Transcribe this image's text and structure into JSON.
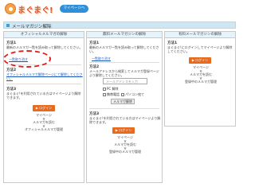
{
  "header": {
    "logo_text": "まぐまぐ!",
    "mypage_label": "マイページへ"
  },
  "title_bar": {
    "title": "メールマガジン解除"
  },
  "col1": {
    "heading": "オフィシャルメルマガの解除",
    "m1_title": "方法1",
    "m1_text_a": "最新のメルマガ一覧を読み取って解除してください。",
    "m1_link": "一覧取り消す",
    "m2_title": "方法2",
    "m2_text": "オフィシャルメルマガ解除ページにて解除してください。",
    "m3_title": "方法3",
    "m3_text": "まぐまぐ!を利用されている方はマイページより解除できます。",
    "login": "▶ ログイン",
    "flow": [
      "マイページ",
      "▼",
      "メルマガを読む",
      "▼",
      "オフィシャルメルマガ管理"
    ]
  },
  "col2": {
    "heading": "無料メールマガジンの解除",
    "m1_title": "方法1",
    "m1_text": "最新のメルマガ一覧を読み取って解除してください。",
    "m1_link": "一覧取り消す",
    "m2_title": "方法2",
    "m2_text": "メールアドレスから検索してメルマガ登録ページより解除してください。",
    "search_placeholder": "メールアドレスを入力",
    "check1": "PC 解除",
    "check2": "携帯電話",
    "check3": "パソコン宛て",
    "submit": "メルマガ解除",
    "m3_title": "方法3",
    "m3_text": "まぐまぐ!を利用されている方はマイページより解除できます。",
    "login": "▶ ログイン",
    "flow": [
      "マイページ",
      "▼",
      "メルマガを読む",
      "▼",
      "登録中のメルマガ管理"
    ]
  },
  "col3": {
    "heading": "有料メールマガジンの解除",
    "m1_title": "方法1",
    "m1_text": "まぐまぐ!にログインしてマイページより解除してください。",
    "login": "▶ ログイン",
    "flow": [
      "マイページ",
      "▼",
      "メルマガを読む",
      "▼",
      "登録中のメルマガ管理"
    ]
  }
}
